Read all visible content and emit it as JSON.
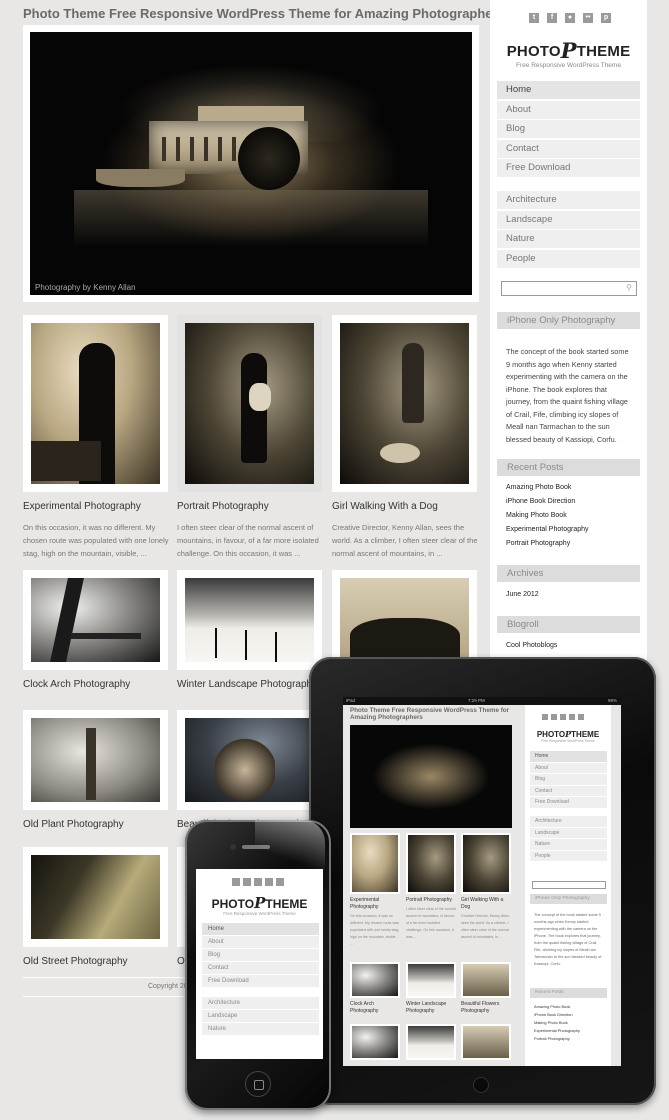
{
  "site": {
    "title": "Photo Theme Free Responsive WordPress Theme for Amazing Photographers",
    "hero_caption": "Photography by Kenny Allan",
    "footer_copyright": "Copyright 20"
  },
  "posts": [
    {
      "title": "Experimental Photography",
      "excerpt": "On this occasion, it was no different. My chosen route was populated with one lonely stag, high on the mountain, visible, ..."
    },
    {
      "title": "Portrait Photography",
      "excerpt": "I often steer clear of the normal ascent of mountains, in favour, of a far more isolated challenge. On this occasion, it was ..."
    },
    {
      "title": "Girl Walking With a Dog",
      "excerpt": "Creative Director, Kenny Allan, sees the world. As a climber, I often steer clear of the normal ascent of mountains, in ..."
    },
    {
      "title": "Clock Arch Photography"
    },
    {
      "title": "Winter Landscape Photography"
    },
    {
      "title": "Beautiful Flowers Photography"
    },
    {
      "title": "Old Plant Photography"
    },
    {
      "title": "Beautiful Winter Photography"
    },
    {
      "title": "Old Street Photography"
    },
    {
      "title": "Ol"
    }
  ],
  "sidebar": {
    "social_icons": [
      "twitter-icon",
      "facebook-icon",
      "rss-icon",
      "flickr-icon",
      "pinterest-icon"
    ],
    "social_glyphs": [
      "t",
      "f",
      "●",
      "••",
      "p"
    ],
    "logo_left": "PHOTO",
    "logo_p": "P",
    "logo_right": "THEME",
    "logo_tagline": "Free Responsive WordPress Theme",
    "menu": [
      "Home",
      "About",
      "Blog",
      "Contact",
      "Free Download"
    ],
    "active_menu": "Home",
    "categories": [
      "Architecture",
      "Landscape",
      "Nature",
      "People"
    ],
    "search_placeholder": "",
    "widgets": {
      "about_title": "iPhone Only Photography",
      "about_text": "The concept of the book started some 9 months ago when Kenny started experimenting with the camera on the iPhone. The book explores that journey, from the quaint fishing village of Crail, Fife, climbing icy slopes of Meall nan Tarmachan to the sun blessed beauty of Kassiopi, Corfu.",
      "recent_title": "Recent Posts",
      "recent_posts": [
        "Amazing Photo Book",
        "iPhone Book Direction",
        "Making Photo Book",
        "Experimental Photography",
        "Portrait Photography"
      ],
      "archives_title": "Archives",
      "archives": [
        "June 2012"
      ],
      "blogroll_title": "Blogroll",
      "blogroll": [
        "Cool Photoblogs"
      ]
    }
  },
  "ipad": {
    "status_left": "iPad",
    "status_time": "7:29 PM",
    "status_right": "98%",
    "title": "Photo Theme Free Responsive WordPress Theme for Amazing Photographers",
    "about_text": "The concept of the book started some 9 months ago when Kenny started experimenting with the camera on the iPhone. The book explores that journey, from the quaint fishing village of Crail, Fife, climbing icy slopes of Meall nan Tarmachan to the sun blessed beauty of Kassiopi, Corfu.",
    "cards": [
      {
        "title": "Experimental Photography",
        "excerpt": "On this occasion, it was no different. My chosen route was populated with one lonely stag, high on the mountain, visible, ..."
      },
      {
        "title": "Portrait Photography",
        "excerpt": "I often steer clear of the normal ascent of mountains, in favour, of a far more isolated challenge. On this occasion, it was ..."
      },
      {
        "title": "Girl Walking With a Dog",
        "excerpt": "Creative Director, Kenny Allan, sees the world. As a climber, I often steer clear of the normal ascent of mountains, in ..."
      },
      {
        "title": "Clock Arch Photography"
      },
      {
        "title": "Winter Landscape Photography"
      },
      {
        "title": "Beautiful Flowers Photography"
      }
    ]
  },
  "iphone": {
    "menu": [
      "Home",
      "About",
      "Blog",
      "Contact",
      "Free Download"
    ],
    "categories": [
      "Architecture",
      "Landscape",
      "Nature"
    ]
  },
  "colors": {
    "page_bg": "#e8e7e5",
    "menu_bg": "#efefef",
    "widget_header_bg": "#dcdcdc",
    "title_text": "#6a6a6a"
  }
}
